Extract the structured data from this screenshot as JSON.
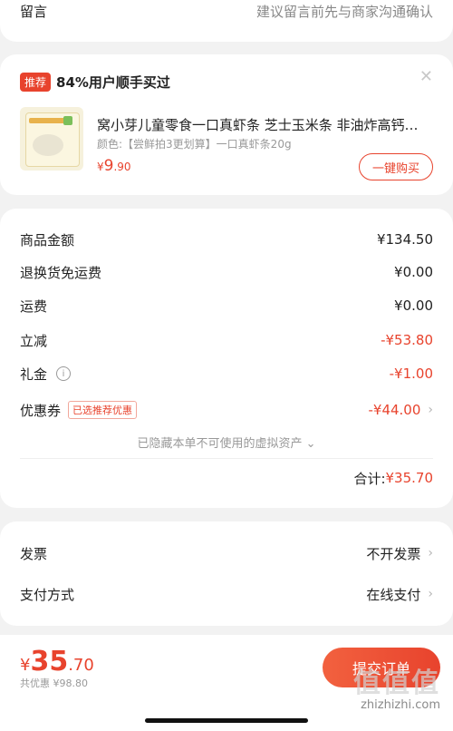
{
  "note": {
    "label": "留言",
    "placeholder": "建议留言前先与商家沟通确认"
  },
  "recommend": {
    "tag": "推荐",
    "headline": "84%用户顺手买过",
    "product": {
      "title": "窝小芽儿童零食一口真虾条 芝士玉米条 非油炸高钙…",
      "variant": "颜色:【尝鲜拍3更划算】一口真虾条20g",
      "price_currency": "¥",
      "price_int": "9",
      "price_dec": ".90",
      "thumb_text": "一口真虾条20g"
    },
    "buy_label": "一键购买"
  },
  "summary": {
    "rows": [
      {
        "label": "商品金额",
        "value": "¥134.50"
      },
      {
        "label": "退换货免运费",
        "value": "¥0.00"
      },
      {
        "label": "运费",
        "value": "¥0.00"
      },
      {
        "label": "立减",
        "value": "-¥53.80"
      },
      {
        "label": "礼金",
        "value": "-¥1.00"
      },
      {
        "label": "优惠券",
        "tag": "已选推荐优惠",
        "value": "-¥44.00"
      }
    ],
    "hidden_assets": "已隐藏本单不可使用的虚拟资产 ⌄",
    "total_label": "合计:",
    "total_value": "¥35.70"
  },
  "invoice": {
    "rows": [
      {
        "label": "发票",
        "value": "不开发票"
      },
      {
        "label": "支付方式",
        "value": "在线支付"
      }
    ]
  },
  "bottom": {
    "currency": "¥",
    "price_int": "35",
    "price_dec": ".70",
    "saved": "共优惠 ¥98.80",
    "submit_label": "提交订单",
    "watermark": "zhizhizhi.com",
    "watermark_logo": "值值值"
  },
  "colors": {
    "accent": "#e8432d",
    "background": "#f2f2f2"
  }
}
